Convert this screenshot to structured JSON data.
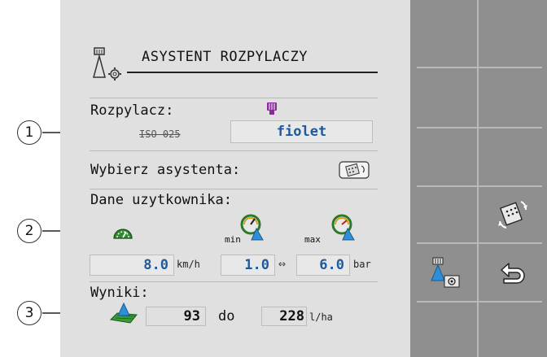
{
  "header": {
    "title": "ASYSTENT ROZPYLACZY"
  },
  "nozzle": {
    "label": "Rozpylacz:",
    "code": "ISO 025",
    "value": "fiolet",
    "color": "#8a2a9c"
  },
  "assistant": {
    "label": "Wybierz asystenta:"
  },
  "user_data": {
    "label": "Dane uzytkownika:",
    "speed": {
      "value": "8.0",
      "unit": "km/h"
    },
    "pressure": {
      "min_label": "min",
      "min_value": "1.0",
      "max_label": "max",
      "max_value": "6.0",
      "unit": "bar"
    }
  },
  "results": {
    "label": "Wyniki:",
    "from": "93",
    "to_word": "do",
    "to": "228",
    "unit": "l/ha"
  },
  "callouts": [
    "1",
    "2",
    "3"
  ],
  "colors": {
    "field_text": "#1e5a9c",
    "panel_bg": "#e0e0e0",
    "softkey_bg": "#8f8f8f"
  },
  "icons": [
    "nozzle-gear-icon",
    "nozzle-purple-icon",
    "calculator-icon",
    "speedometer-icon",
    "pressure-gauge-icon",
    "field-spray-icon",
    "nozzle-settings-icon",
    "back-arrow-icon"
  ]
}
